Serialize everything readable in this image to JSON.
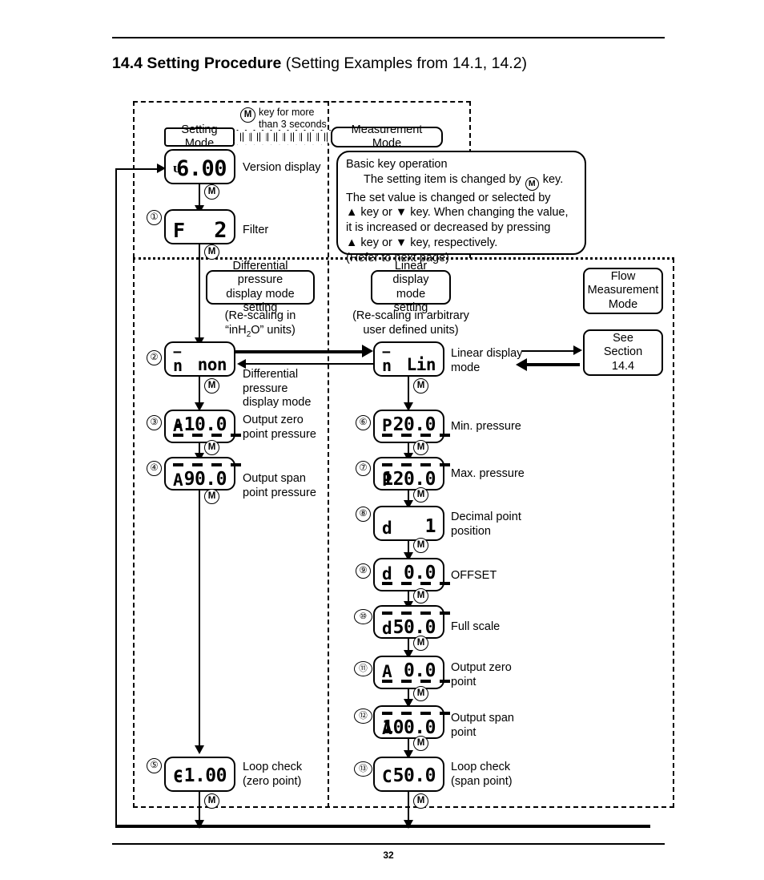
{
  "page": {
    "number": "32",
    "heading_bold": "14.4 Setting Procedure",
    "heading_rest": " (Setting Examples from 14.1, 14.2)"
  },
  "top": {
    "mkey_note": "key for more\nthan 3 seconds",
    "setting_mode": "Setting Mode",
    "measurement_mode": "Measurement Mode",
    "keyop": {
      "title": "Basic key operation",
      "l1a": "The setting item is changed by ",
      "l1b": " key.",
      "l2": "The set value is changed or selected by",
      "l3": "▲ key or ▼ key. When changing the value,",
      "l4": "it is increased or decreased by pressing",
      "l5": "▲ key or ▼ key, respectively.",
      "l6": "(Refer to next page)"
    }
  },
  "branch_labels": {
    "diff_mode_setting": "Differential pressure\ndisplay mode setting",
    "diff_rescale": "(Re-scaling in\n“inH",
    "diff_rescale_sub": "2",
    "diff_rescale_end": "O” units)",
    "linear_mode_setting": "Linear display\nmode setting",
    "linear_rescale": "(Re-scaling in arbitrary\nuser defined units)",
    "flow_measurement_mode": "Flow\nMeasurement\nMode",
    "see_section": "See\nSection\n14.4"
  },
  "displays": [
    {
      "id": "version",
      "lead": "ᴜ",
      "value": "6.00",
      "segs": "none",
      "label": "Version display",
      "step": ""
    },
    {
      "id": "filter",
      "lead": "F",
      "value": "2",
      "segs": "none",
      "label": "Filter",
      "step": "①"
    },
    {
      "id": "diff-mode",
      "lead": "n",
      "overbar": true,
      "value": "non",
      "segs": "none",
      "label": "Differential\npressure\ndisplay mode",
      "step": "②"
    },
    {
      "id": "out-zero-press",
      "lead": "A",
      "value": "-10.0",
      "segs": "below",
      "label": "Output zero\npoint pressure",
      "step": "③"
    },
    {
      "id": "out-span-press",
      "lead": "A",
      "value": "90.0",
      "segs": "above",
      "label": "Output span\npoint pressure",
      "step": "④"
    },
    {
      "id": "loop-check-zero",
      "lead": "C",
      "value": "-1.00",
      "segs": "none",
      "label": "Loop check\n(zero point)",
      "step": "⑤"
    },
    {
      "id": "linear-mode",
      "lead": "n",
      "overbar": true,
      "value": "Lin",
      "segs": "none",
      "label": "Linear display\nmode",
      "step": ""
    },
    {
      "id": "min-pressure",
      "lead": "P",
      "value": "20.0",
      "segs": "below",
      "label": "Min. pressure",
      "step": "⑥"
    },
    {
      "id": "max-pressure",
      "lead": "P",
      "value": "120.0",
      "segs": "above",
      "label": "Max. pressure",
      "step": "⑦"
    },
    {
      "id": "decimal-point",
      "lead": "d",
      "value": "1",
      "segs": "none",
      "label": "Decimal point\nposition",
      "step": "⑧"
    },
    {
      "id": "offset",
      "lead": "d",
      "value": "0.0",
      "segs": "below",
      "label": "OFFSET",
      "step": "⑨"
    },
    {
      "id": "full-scale",
      "lead": "d",
      "value": "50.0",
      "segs": "above",
      "label": "Full scale",
      "step": "⑩"
    },
    {
      "id": "output-zero-point",
      "lead": "A",
      "value": "0.0",
      "segs": "below",
      "label": "Output zero\npoint",
      "step": "⑪"
    },
    {
      "id": "output-span-point",
      "lead": "A",
      "value": "100.0",
      "segs": "above",
      "label": "Output span\npoint",
      "step": "⑫"
    },
    {
      "id": "loop-check-span",
      "lead": "C",
      "value": "50.0",
      "segs": "none",
      "label": "Loop check\n(span point)",
      "step": "⑬"
    }
  ],
  "mkey_glyph": "M"
}
